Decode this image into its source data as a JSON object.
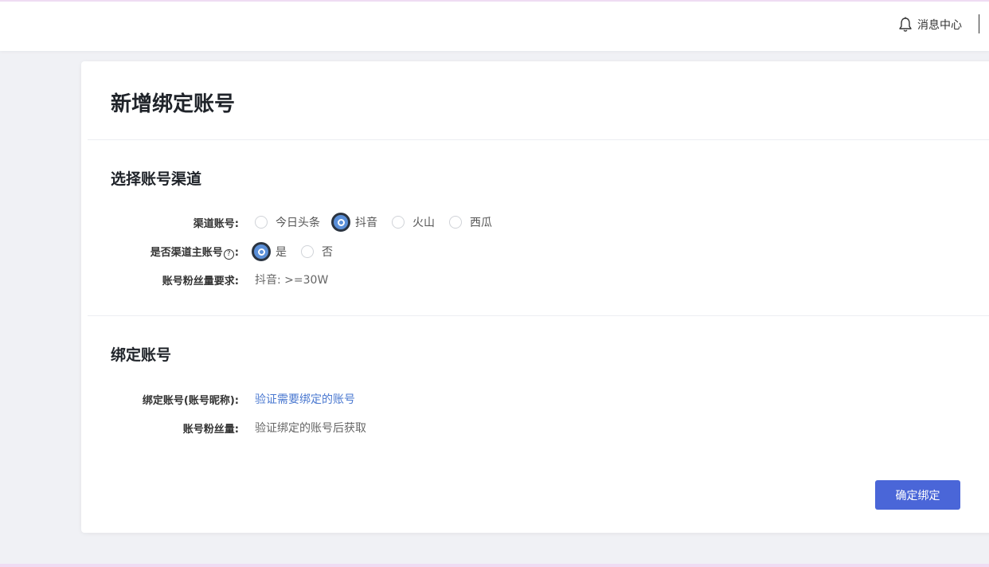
{
  "header": {
    "message_center_label": "消息中心",
    "message_center_icon": "bell-icon"
  },
  "page": {
    "title": "新增绑定账号"
  },
  "channel_section": {
    "title": "选择账号渠道",
    "channel_label": "渠道账号:",
    "channel_options": [
      "今日头条",
      "抖音",
      "火山",
      "西瓜"
    ],
    "channel_selected": "抖音",
    "main_account_label": "是否渠道主账号",
    "main_account_label_suffix": ":",
    "help_icon": "question-circle-icon",
    "help_icon_glyph": "?",
    "main_account_options": [
      "是",
      "否"
    ],
    "main_account_selected": "是",
    "fans_requirement_label": "账号粉丝量要求:",
    "fans_requirement_value": "抖音: >=30W"
  },
  "bind_section": {
    "title": "绑定账号",
    "account_label": "绑定账号(账号昵称):",
    "account_link": "验证需要绑定的账号",
    "fans_label": "账号粉丝量:",
    "fans_value": "验证绑定的账号后获取"
  },
  "actions": {
    "confirm_label": "确定绑定",
    "accent_color": "#4a66d8"
  }
}
